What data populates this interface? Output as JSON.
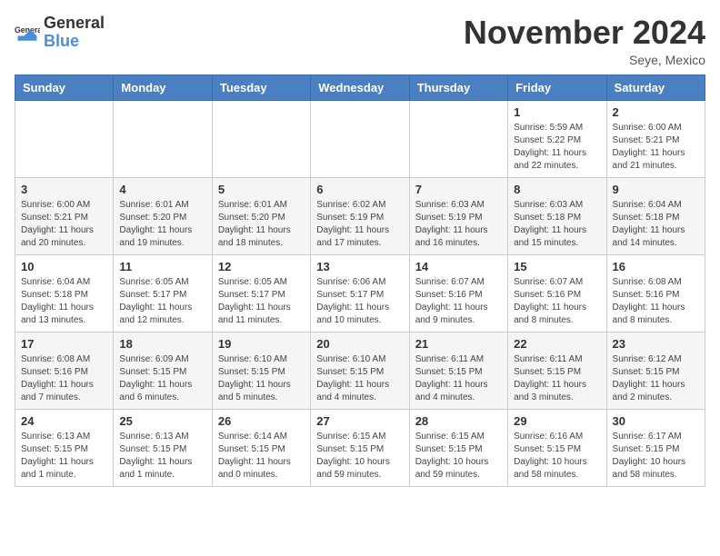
{
  "header": {
    "logo_general": "General",
    "logo_blue": "Blue",
    "month_title": "November 2024",
    "location": "Seye, Mexico"
  },
  "weekdays": [
    "Sunday",
    "Monday",
    "Tuesday",
    "Wednesday",
    "Thursday",
    "Friday",
    "Saturday"
  ],
  "weeks": [
    [
      {
        "day": "",
        "info": ""
      },
      {
        "day": "",
        "info": ""
      },
      {
        "day": "",
        "info": ""
      },
      {
        "day": "",
        "info": ""
      },
      {
        "day": "",
        "info": ""
      },
      {
        "day": "1",
        "info": "Sunrise: 5:59 AM\nSunset: 5:22 PM\nDaylight: 11 hours and 22 minutes."
      },
      {
        "day": "2",
        "info": "Sunrise: 6:00 AM\nSunset: 5:21 PM\nDaylight: 11 hours and 21 minutes."
      }
    ],
    [
      {
        "day": "3",
        "info": "Sunrise: 6:00 AM\nSunset: 5:21 PM\nDaylight: 11 hours and 20 minutes."
      },
      {
        "day": "4",
        "info": "Sunrise: 6:01 AM\nSunset: 5:20 PM\nDaylight: 11 hours and 19 minutes."
      },
      {
        "day": "5",
        "info": "Sunrise: 6:01 AM\nSunset: 5:20 PM\nDaylight: 11 hours and 18 minutes."
      },
      {
        "day": "6",
        "info": "Sunrise: 6:02 AM\nSunset: 5:19 PM\nDaylight: 11 hours and 17 minutes."
      },
      {
        "day": "7",
        "info": "Sunrise: 6:03 AM\nSunset: 5:19 PM\nDaylight: 11 hours and 16 minutes."
      },
      {
        "day": "8",
        "info": "Sunrise: 6:03 AM\nSunset: 5:18 PM\nDaylight: 11 hours and 15 minutes."
      },
      {
        "day": "9",
        "info": "Sunrise: 6:04 AM\nSunset: 5:18 PM\nDaylight: 11 hours and 14 minutes."
      }
    ],
    [
      {
        "day": "10",
        "info": "Sunrise: 6:04 AM\nSunset: 5:18 PM\nDaylight: 11 hours and 13 minutes."
      },
      {
        "day": "11",
        "info": "Sunrise: 6:05 AM\nSunset: 5:17 PM\nDaylight: 11 hours and 12 minutes."
      },
      {
        "day": "12",
        "info": "Sunrise: 6:05 AM\nSunset: 5:17 PM\nDaylight: 11 hours and 11 minutes."
      },
      {
        "day": "13",
        "info": "Sunrise: 6:06 AM\nSunset: 5:17 PM\nDaylight: 11 hours and 10 minutes."
      },
      {
        "day": "14",
        "info": "Sunrise: 6:07 AM\nSunset: 5:16 PM\nDaylight: 11 hours and 9 minutes."
      },
      {
        "day": "15",
        "info": "Sunrise: 6:07 AM\nSunset: 5:16 PM\nDaylight: 11 hours and 8 minutes."
      },
      {
        "day": "16",
        "info": "Sunrise: 6:08 AM\nSunset: 5:16 PM\nDaylight: 11 hours and 8 minutes."
      }
    ],
    [
      {
        "day": "17",
        "info": "Sunrise: 6:08 AM\nSunset: 5:16 PM\nDaylight: 11 hours and 7 minutes."
      },
      {
        "day": "18",
        "info": "Sunrise: 6:09 AM\nSunset: 5:15 PM\nDaylight: 11 hours and 6 minutes."
      },
      {
        "day": "19",
        "info": "Sunrise: 6:10 AM\nSunset: 5:15 PM\nDaylight: 11 hours and 5 minutes."
      },
      {
        "day": "20",
        "info": "Sunrise: 6:10 AM\nSunset: 5:15 PM\nDaylight: 11 hours and 4 minutes."
      },
      {
        "day": "21",
        "info": "Sunrise: 6:11 AM\nSunset: 5:15 PM\nDaylight: 11 hours and 4 minutes."
      },
      {
        "day": "22",
        "info": "Sunrise: 6:11 AM\nSunset: 5:15 PM\nDaylight: 11 hours and 3 minutes."
      },
      {
        "day": "23",
        "info": "Sunrise: 6:12 AM\nSunset: 5:15 PM\nDaylight: 11 hours and 2 minutes."
      }
    ],
    [
      {
        "day": "24",
        "info": "Sunrise: 6:13 AM\nSunset: 5:15 PM\nDaylight: 11 hours and 1 minute."
      },
      {
        "day": "25",
        "info": "Sunrise: 6:13 AM\nSunset: 5:15 PM\nDaylight: 11 hours and 1 minute."
      },
      {
        "day": "26",
        "info": "Sunrise: 6:14 AM\nSunset: 5:15 PM\nDaylight: 11 hours and 0 minutes."
      },
      {
        "day": "27",
        "info": "Sunrise: 6:15 AM\nSunset: 5:15 PM\nDaylight: 10 hours and 59 minutes."
      },
      {
        "day": "28",
        "info": "Sunrise: 6:15 AM\nSunset: 5:15 PM\nDaylight: 10 hours and 59 minutes."
      },
      {
        "day": "29",
        "info": "Sunrise: 6:16 AM\nSunset: 5:15 PM\nDaylight: 10 hours and 58 minutes."
      },
      {
        "day": "30",
        "info": "Sunrise: 6:17 AM\nSunset: 5:15 PM\nDaylight: 10 hours and 58 minutes."
      }
    ]
  ]
}
